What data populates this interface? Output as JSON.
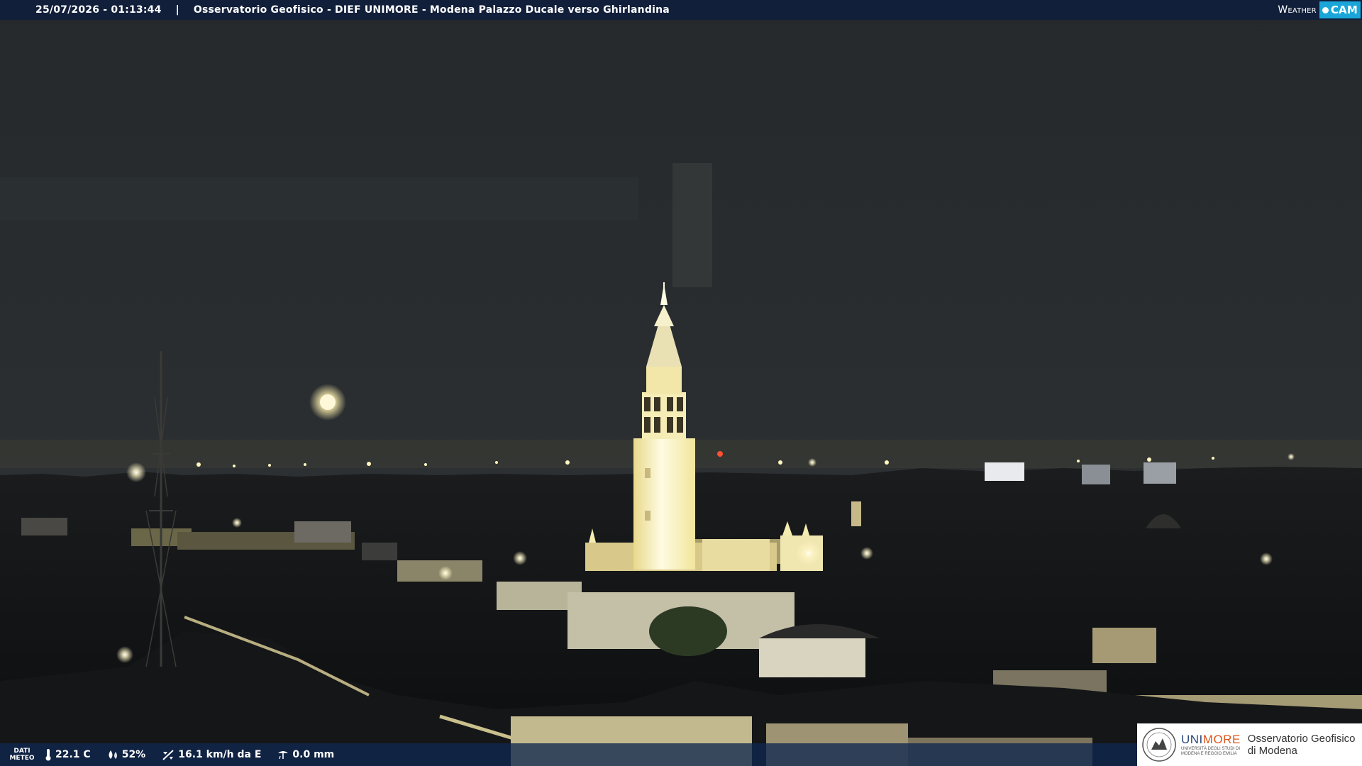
{
  "header": {
    "timestamp": "25/07/2026 - 01:13:44",
    "separator": "|",
    "title": "Osservatorio Geofisico - DIEF UNIMORE - Modena Palazzo Ducale verso Ghirlandina"
  },
  "brand": {
    "weather": "Weather",
    "cam": "CAM"
  },
  "weather_data": {
    "label_line1": "DATI",
    "label_line2": "METEO",
    "temperature": "22.1 C",
    "humidity": "52%",
    "wind": "16.1 km/h da E",
    "rain": "0.0 mm"
  },
  "logo": {
    "unimore_part1": "UNI",
    "unimore_part2": "MORE",
    "unimore_sub1": "UNIVERSITÀ DEGLI STUDI DI",
    "unimore_sub2": "MODENA E REGGIO EMILIA",
    "osservatorio_line1": "Osservatorio Geofisico",
    "osservatorio_line2": "di Modena"
  },
  "colors": {
    "topbar_bg": "#0f1e3c",
    "cam_accent": "#1aa6d9",
    "unimore_blue": "#2a4a7a",
    "unimore_orange": "#e0551a",
    "sky": "#262a2e",
    "tower_light": "#fff3b0"
  }
}
